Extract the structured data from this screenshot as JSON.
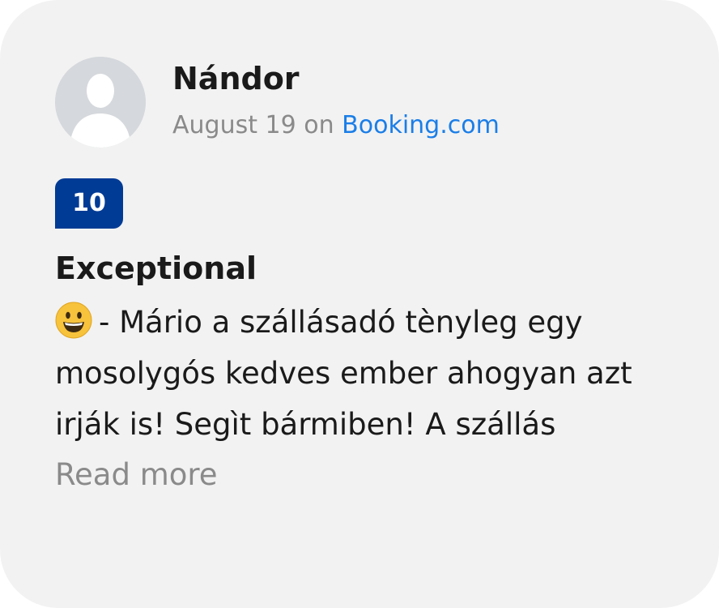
{
  "review": {
    "reviewer_name": "Nándor",
    "date": "August 19",
    "on_text": "on",
    "source": "Booking.com",
    "score": "10",
    "score_label": "Exceptional",
    "emoji_icon": "grinning-face-emoji",
    "text": "- Mário a szállásadó tènyleg egy mosolygós kedves ember ahogyan azt irják is! Segìt bármiben! A szállás",
    "read_more": "Read more"
  },
  "colors": {
    "card_background": "#f2f2f2",
    "score_badge": "#003b95",
    "link": "#1a7ee8",
    "muted_text": "#8a8a8a"
  }
}
